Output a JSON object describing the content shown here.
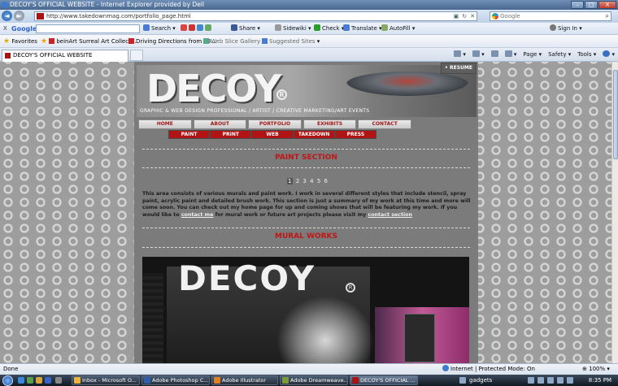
{
  "browser": {
    "title": "DECOY'S OFFICIAL WEBSITE - Internet Explorer provided by Dell",
    "window_controls": {
      "minimize": "–",
      "maximize": "□",
      "close": "X"
    },
    "address": "http://www.takedownmag.com/portfolio_page.html",
    "search_placeholder": "Google",
    "nav": {
      "back": "◄",
      "forward": "►"
    }
  },
  "google_toolbar": {
    "close": "X",
    "logo": "Google",
    "items": [
      "Search",
      "Share",
      "Sidewiki",
      "Check",
      "Translate",
      "AutoFill",
      "Sign In"
    ]
  },
  "favorites_bar": {
    "favorites_label": "Favorites",
    "links": [
      "beinArt Surreal Art Collect...",
      "Driving Directions from 73...",
      "Web Slice Gallery",
      "Suggested Sites"
    ]
  },
  "tabs": {
    "active_tab": "DECOY'S OFFICIAL WEBSITE",
    "commands": [
      "Page",
      "Safety",
      "Tools"
    ]
  },
  "site": {
    "logo": "DECOY",
    "logo_mark": "R",
    "tagline": "GRAPHIC & WEB DESIGN PROFESSIONAL / ARTIST / CREATIVE MARKETING/ART EVENTS",
    "resume_button": "• RESUME",
    "main_nav": [
      "HOME",
      "ABOUT",
      "PORTFOLIO",
      "EXHIBITS",
      "CONTACT"
    ],
    "sub_nav": [
      "PAINT",
      "PRINT",
      "WEB",
      "TAKEDOWN",
      "PRESS"
    ],
    "section_title": "PAINT SECTION",
    "pager": {
      "current": "1",
      "pages": [
        "2",
        "3",
        "4",
        "5",
        "6"
      ]
    },
    "description_part1": "This area consists of various murals and paint work. I work in several different styles that include stencil, spray paint, acrylic paint and detailed brush work. This section is just a summary of my work at this time and more will come soon. You can check out my home page for up and coming shows that will be featuring my work. If you would like to ",
    "description_link1": "contact me",
    "description_part2": " for mural work or future art projects please visit my ",
    "description_link2": "contact section",
    "mural_title": "MURAL WORKS",
    "photo_text": "DECOY"
  },
  "status": {
    "left": "Done",
    "zone": "Internet | Protected Mode: On",
    "zoom": "100%"
  },
  "taskbar": {
    "buttons": [
      "Inbox - Microsoft O...",
      "Adobe Photoshop C...",
      "Adobe Illustrator",
      "Adobe Dreamweave...",
      "DECOY'S OFFICIAL ..."
    ],
    "gadgets": "gadgets",
    "clock": "8:35 PM"
  },
  "colors": {
    "accent_red": "#c01616",
    "page_bg": "#7b7b7b",
    "pattern_bg": "#9d9d9d"
  }
}
